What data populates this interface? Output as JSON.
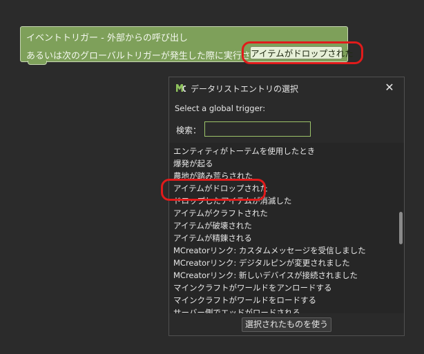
{
  "block": {
    "line1": "イベントトリガー - 外部からの呼び出し",
    "line2": "あるいは次のグローバルトリガーが発生した際に実行される",
    "field_value": "アイテムがドロップされた",
    "color": "#7ea05a"
  },
  "dialog": {
    "title": "データリストエントリの選択",
    "icon": "mcreator-logo-icon",
    "close_icon": "close-icon",
    "close_glyph": "✕",
    "prompt": "Select a global trigger:",
    "search_label": "検索：",
    "search_value": "",
    "items": [
      "エンティティがトーテムを使用したとき",
      "爆発が起る",
      "農地が踏み荒らされた",
      "アイテムがドロップされた",
      "ドロップしたアイテムが消滅した",
      "アイテムがクラフトされた",
      "アイテムが破壊された",
      "アイテムが精錬される",
      "MCreatorリンク: カスタムメッセージを受信しました",
      "MCreatorリンク: デジタルピンが変更されました",
      "MCreatorリンク: 新しいデバイスが接続されました",
      "マインクラフトがワールドをアンロードする",
      "マインクラフトがワールドをロードする",
      "サーバー側でエッドがロードされる"
    ],
    "use_button": "選択されたものを使う",
    "accent": "#9dc46a"
  },
  "highlight_color": "#e01b1b"
}
